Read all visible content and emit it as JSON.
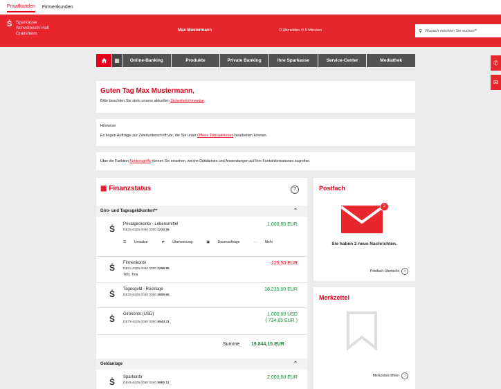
{
  "topnav": {
    "tab1": "Privatkunden",
    "tab2": "Firmenkunden"
  },
  "header": {
    "logo_line1": "Sparkasse",
    "logo_line2": "Schwäbisch Hall",
    "logo_line3": "Crailsheim",
    "user_name": "Max Mustermann",
    "logout": "Abmelden",
    "session": "5 Minuten",
    "search_placeholder": "Wonach möchten Sie suchen?"
  },
  "nav": [
    "Online-Banking",
    "Produkte",
    "Private Banking",
    "Ihre Sparkasse",
    "Service-Center",
    "Mediathek"
  ],
  "greeting": {
    "title": "Guten Tag Max Mustermann,",
    "text_pre": "Bitte beachten Sie stets unsere aktuellen ",
    "link": "Sicherheitshinweise",
    "text_post": "."
  },
  "hint": {
    "heading": "Hinweise",
    "text_pre": "Es liegen Aufträge zur Zweitunterschrift vor, die Sie unter ",
    "link": "Offene Transaktionen",
    "text_post": " bearbeiten können."
  },
  "info": {
    "text_pre": "Über die Funktion ",
    "link": "Kontozugriffe",
    "text_post": " können Sie einsehen, welche Drittdienste und Anwendungen auf Ihre Kontoinformationen zugreifen."
  },
  "finanzstatus": {
    "title": "Finanzstatus",
    "help": "?",
    "section1": "Giro- und Tagesgeldkonten**",
    "section2": "Geldanlage",
    "accounts": [
      {
        "name": "Privatgirokonto - Lebensmittel",
        "iban": "DE35 6225 0030 0000 ",
        "iban_hl": "1234 56",
        "owner": "",
        "amount": "1.000,00 EUR",
        "amount2": ""
      },
      {
        "name": "Firmenkonto",
        "iban": "DE22 6225 0030 0000 ",
        "iban_hl": "1299 95",
        "owner": "Test, Tina",
        "amount": "-125,50 EUR",
        "amount2": ""
      },
      {
        "name": "Tagesgeld - Rücklage",
        "iban": "DE38 6225 0030 0000 ",
        "iban_hl": "2809 65",
        "owner": "",
        "amount": "18.235,00 EUR",
        "amount2": ""
      },
      {
        "name": "Girokonto (USD)",
        "iban": "DE79 6225 0030 0000 ",
        "iban_hl": "6543 21",
        "owner": "",
        "amount": "1.000,00 USD",
        "amount2": "( 734,65 EUR )"
      },
      {
        "name": "Sparkonto",
        "iban": "DE45 6225 0030 0040 ",
        "iban_hl": "5800 11",
        "owner": "",
        "amount": "2.000,00 EUR",
        "amount2": ""
      }
    ],
    "actions": [
      "Umsätze",
      "Überweisung",
      "Daueraufträge",
      "Mehr"
    ],
    "sum_label": "Summe",
    "sum_value": "19.844,15 EUR"
  },
  "postfach": {
    "title": "Postfach",
    "badge": "2",
    "message": "Sie haben 2 neue Nachrichten.",
    "link": "Postfach-Übersicht"
  },
  "merkzettel": {
    "title": "Merkzettel",
    "link": "Merkzettel öffnen"
  },
  "colors": {
    "brand_red": "#e8262d",
    "nav_gray": "#525252",
    "positive": "#1a8a3c",
    "negative": "#e2001a"
  }
}
